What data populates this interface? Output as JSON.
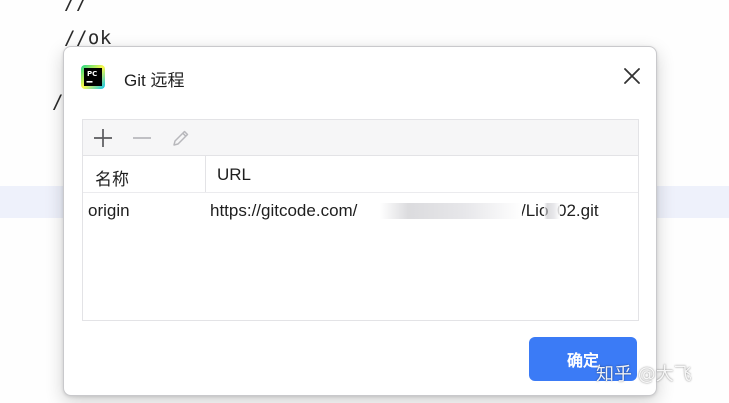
{
  "editor": {
    "lines": [
      "//",
      "//ok",
      "/"
    ]
  },
  "dialog": {
    "title": "Git 远程",
    "icon": "pycharm-app-icon",
    "app_icon_text": "PC",
    "toolbar": {
      "add_icon": "plus-icon",
      "remove_icon": "minus-icon",
      "edit_icon": "pencil-icon"
    },
    "table": {
      "columns": [
        "名称",
        "URL"
      ],
      "rows": [
        {
          "name": "origin",
          "url_start": "https://gitcode.com/",
          "url_end": "/Lio",
          "url_tail": "02.git"
        }
      ]
    },
    "ok_button": "确定"
  },
  "watermark": "知乎 @大飞",
  "colors": {
    "accent": "#3b7bf6",
    "highlight": "#eef1fb"
  }
}
